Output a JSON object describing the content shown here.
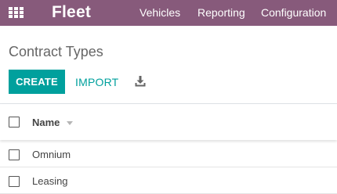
{
  "navbar": {
    "brand": "Fleet",
    "menu": {
      "vehicles": "Vehicles",
      "reporting": "Reporting",
      "configuration": "Configuration"
    },
    "apps_icon": "apps-grid-icon",
    "color": "#875a7b"
  },
  "control_panel": {
    "title": "Contract Types",
    "create_label": "CREATE",
    "import_label": "IMPORT",
    "download_icon": "download-icon",
    "accent_color": "#00a09d"
  },
  "list": {
    "columns": [
      "Name"
    ],
    "rows": [
      {
        "name": "Omnium"
      },
      {
        "name": "Leasing"
      }
    ]
  }
}
